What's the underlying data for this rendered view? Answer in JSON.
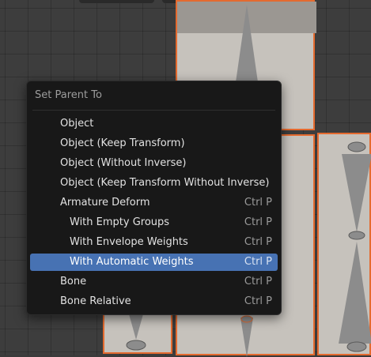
{
  "menu": {
    "title": "Set Parent To",
    "items": [
      {
        "label": "Object",
        "shortcut": "",
        "indent": false,
        "active": false
      },
      {
        "label": "Object (Keep Transform)",
        "shortcut": "",
        "indent": false,
        "active": false
      },
      {
        "label": "Object (Without Inverse)",
        "shortcut": "",
        "indent": false,
        "active": false
      },
      {
        "label": "Object (Keep Transform Without Inverse)",
        "shortcut": "",
        "indent": false,
        "active": false
      },
      {
        "label": "Armature Deform",
        "shortcut": "Ctrl P",
        "indent": false,
        "active": false
      },
      {
        "label": "With Empty Groups",
        "shortcut": "Ctrl P",
        "indent": true,
        "active": false
      },
      {
        "label": "With Envelope Weights",
        "shortcut": "Ctrl P",
        "indent": true,
        "active": false
      },
      {
        "label": "With Automatic Weights",
        "shortcut": "Ctrl P",
        "indent": true,
        "active": true
      },
      {
        "label": "Bone",
        "shortcut": "Ctrl P",
        "indent": false,
        "active": false
      },
      {
        "label": "Bone Relative",
        "shortcut": "Ctrl P",
        "indent": false,
        "active": false
      }
    ]
  },
  "colors": {
    "highlight": "#4772b3",
    "selection_outline": "#e46a2f",
    "mesh_fill": "#c6c2bc",
    "bone": "#8c8c8c"
  }
}
